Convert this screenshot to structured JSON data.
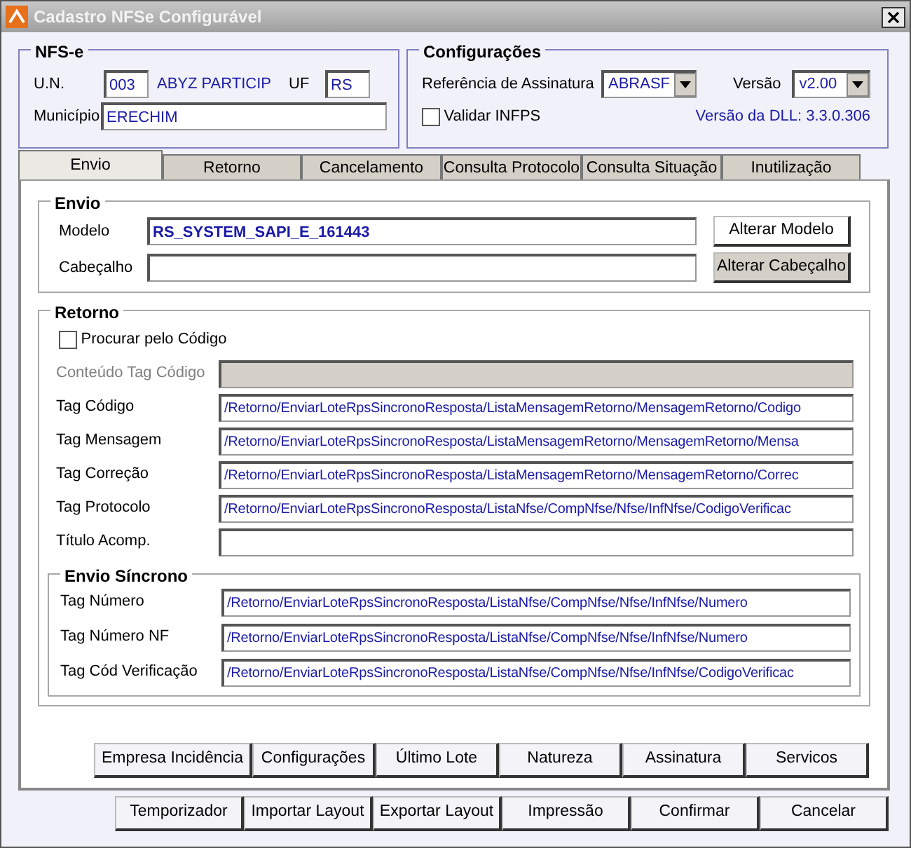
{
  "window": {
    "title": "Cadastro NFSe Configurável"
  },
  "nfse": {
    "title": "NFS-e",
    "un_label": "U.N.",
    "un_value": "003",
    "company": "ABYZ PARTICIP",
    "uf_label": "UF",
    "uf_value": "RS",
    "municipio_label": "Município",
    "municipio_value": "ERECHIM"
  },
  "config": {
    "title": "Configurações",
    "ref_label": "Referência de Assinatura",
    "ref_value": "ABRASF",
    "versao_label": "Versão",
    "versao_value": "v2.00",
    "validar": {
      "label": "Validar INFPS",
      "checked": false
    },
    "dll": "Versão da DLL: 3.3.0.306"
  },
  "tabs": [
    {
      "label": "Envio",
      "selected": true
    },
    {
      "label": "Retorno",
      "selected": false
    },
    {
      "label": "Cancelamento",
      "selected": false
    },
    {
      "label": "Consulta Protocolo",
      "selected": false
    },
    {
      "label": "Consulta Situação",
      "selected": false
    },
    {
      "label": "Inutilização",
      "selected": false
    }
  ],
  "envio": {
    "title": "Envio",
    "fields": [
      {
        "label": "Modelo",
        "value": "RS_SYSTEM_SAPI_E_161443",
        "bold": true,
        "button": "Alterar Modelo",
        "button_default": true
      },
      {
        "label": "Cabeçalho",
        "button": "Alterar Cabeçalho",
        "button_default": false
      }
    ]
  },
  "retorno": {
    "title": "Retorno",
    "procurar": {
      "label": "Procurar pelo Código",
      "checked": false
    },
    "fields": [
      {
        "label": "Conteúdo Tag Código",
        "disabled": true
      },
      {
        "label": "Tag Código",
        "value": "/Retorno/EnviarLoteRpsSincronoResposta/ListaMensagemRetorno/MensagemRetorno/Codigo",
        "disabled": false
      },
      {
        "label": "Tag Mensagem",
        "value": "/Retorno/EnviarLoteRpsSincronoResposta/ListaMensagemRetorno/MensagemRetorno/Mensa",
        "disabled": false
      },
      {
        "label": "Tag Correção",
        "value": "/Retorno/EnviarLoteRpsSincronoResposta/ListaMensagemRetorno/MensagemRetorno/Correc",
        "disabled": false
      },
      {
        "label": "Tag Protocolo",
        "value": "/Retorno/EnviarLoteRpsSincronoResposta/ListaNfse/CompNfse/Nfse/InfNfse/CodigoVerificac",
        "disabled": false
      },
      {
        "label": "Título Acomp.",
        "disabled": false
      }
    ],
    "sincrono": {
      "title": "Envio Síncrono",
      "fields": [
        {
          "label": "Tag Número",
          "value": "/Retorno/EnviarLoteRpsSincronoResposta/ListaNfse/CompNfse/Nfse/InfNfse/Numero"
        },
        {
          "label": "Tag Número NF",
          "value": "/Retorno/EnviarLoteRpsSincronoResposta/ListaNfse/CompNfse/Nfse/InfNfse/Numero"
        },
        {
          "label": "Tag Cód Verificação",
          "value": "/Retorno/EnviarLoteRpsSincronoResposta/ListaNfse/CompNfse/Nfse/InfNfse/CodigoVerificac"
        }
      ]
    }
  },
  "tab_buttons": [
    "Empresa Incidência",
    "Configurações",
    "Último Lote",
    "Natureza",
    "Assinatura",
    "Servicos"
  ],
  "footer_buttons": [
    "Temporizador",
    "Importar Layout",
    "Exportar Layout",
    "Impressão",
    "Confirmar",
    "Cancelar"
  ]
}
